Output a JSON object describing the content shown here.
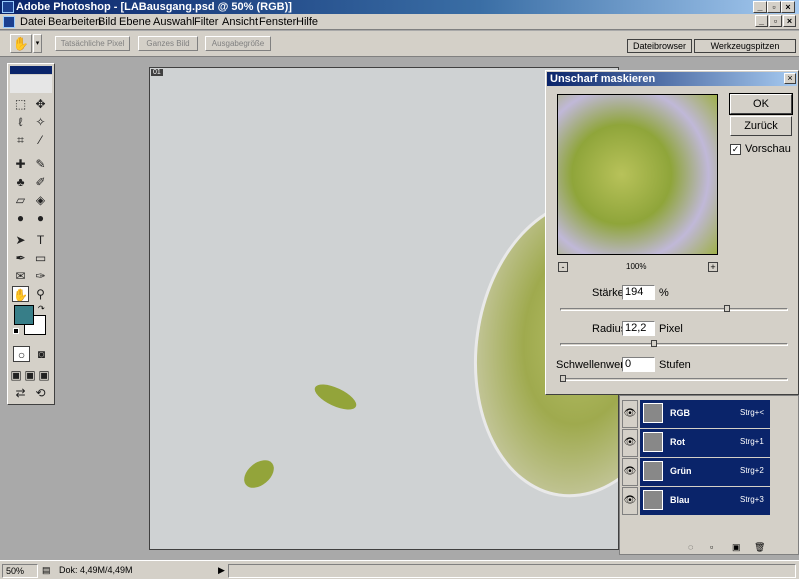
{
  "window": {
    "title": "Adobe Photoshop - [LABausgang.psd @ 50% (RGB)]"
  },
  "menu": [
    "Datei",
    "Bearbeiten",
    "Bild",
    "Ebene",
    "Auswahl",
    "Filter",
    "Ansicht",
    "Fenster",
    "Hilfe"
  ],
  "options_bar": {
    "actual_pixels": "Tatsächliche Pixel",
    "fit_on_screen": "Ganzes Bild",
    "print_size": "Ausgabegröße",
    "tab_filebrowser": "Dateibrowser",
    "tab_toolpresets": "Werkzeugspitzen"
  },
  "document": {
    "badge": "01"
  },
  "colors": {
    "foreground": "#377e88",
    "background": "#ffffff",
    "accent": "#0a246a"
  },
  "dialog": {
    "title": "Unscharf maskieren",
    "ok": "OK",
    "reset": "Zurück",
    "preview_label": "Vorschau",
    "preview_checked": true,
    "zoom": "100%",
    "amount": {
      "label": "Stärke:",
      "value": "194",
      "unit": "%",
      "fraction": 0.74
    },
    "radius": {
      "label": "Radius:",
      "value": "12,2",
      "unit": "Pixel",
      "fraction": 0.41
    },
    "threshold": {
      "label": "Schwellenwert:",
      "value": "0",
      "unit": "Stufen",
      "fraction": 0.0
    }
  },
  "channels": [
    {
      "name": "RGB",
      "shortcut": "Strg+<"
    },
    {
      "name": "Rot",
      "shortcut": "Strg+1"
    },
    {
      "name": "Grün",
      "shortcut": "Strg+2"
    },
    {
      "name": "Blau",
      "shortcut": "Strg+3"
    }
  ],
  "status": {
    "zoom": "50%",
    "doc": "Dok: 4,49M/4,49M"
  }
}
